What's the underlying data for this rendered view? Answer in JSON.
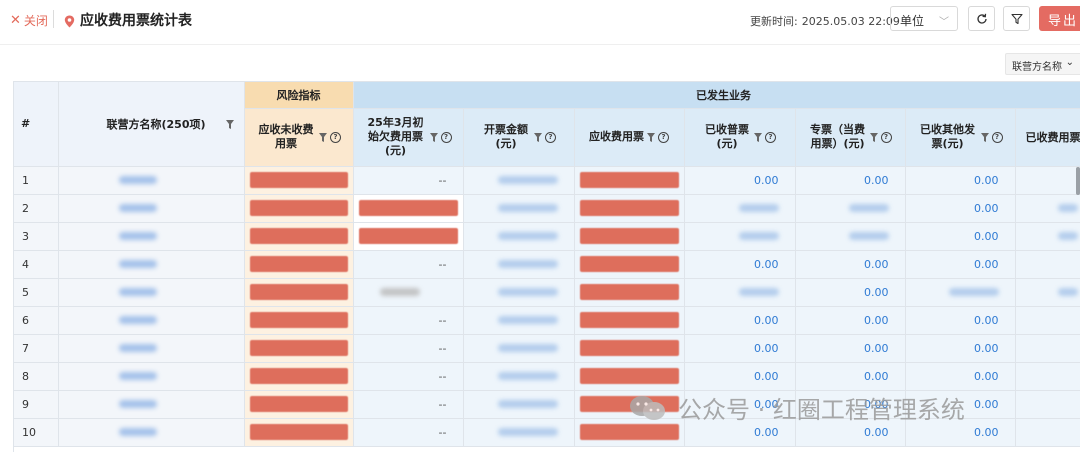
{
  "topbar": {
    "close_label": "关闭",
    "title": "应收费用票统计表",
    "update_label": "更新时间:",
    "update_time": "2025.05.03 22:09",
    "unit_label": "单位",
    "export_label": "导出"
  },
  "filter": {
    "partner_label": "联营方名称"
  },
  "table": {
    "header_idx": "#",
    "header_name": "联营方名称(250项)",
    "group_risk": "风险指标",
    "group_biz": "已发生业务",
    "col_risk": "应收未收费用票",
    "col_mar": "25年3月初始欠费用票(元)",
    "col_invoice": "开票金额(元)",
    "col_receivable": "应收费用票",
    "col_received_normal": "已收普票(元)",
    "col_special": "专票（当费用票）(元)",
    "col_other": "已收其他发票(元)",
    "col_received_fee": "已收费用票",
    "rows": [
      {
        "idx": "1",
        "mar": "--",
        "rn": "0.00",
        "sp": "0.00",
        "ot": "0.00"
      },
      {
        "idx": "2",
        "mar": "",
        "rn": "",
        "sp": "",
        "ot": "0.00"
      },
      {
        "idx": "3",
        "mar": "",
        "rn": "",
        "sp": "",
        "ot": "0.00"
      },
      {
        "idx": "4",
        "mar": "--",
        "rn": "0.00",
        "sp": "0.00",
        "ot": "0.00"
      },
      {
        "idx": "5",
        "mar": "",
        "rn": "",
        "sp": "0.00",
        "ot": ""
      },
      {
        "idx": "6",
        "mar": "--",
        "rn": "0.00",
        "sp": "0.00",
        "ot": "0.00"
      },
      {
        "idx": "7",
        "mar": "--",
        "rn": "0.00",
        "sp": "0.00",
        "ot": "0.00"
      },
      {
        "idx": "8",
        "mar": "--",
        "rn": "0.00",
        "sp": "0.00",
        "ot": "0.00"
      },
      {
        "idx": "9",
        "mar": "--",
        "rn": "0.00",
        "sp": "0.00",
        "ot": "0.00"
      },
      {
        "idx": "10",
        "mar": "--",
        "rn": "0.00",
        "sp": "0.00",
        "ot": "0.00"
      }
    ]
  },
  "watermark": {
    "text": "公众号 · 红圈工程管理系统"
  },
  "colors": {
    "accent": "#e46b62",
    "risk_bg": "#fdf1e1",
    "biz_bg": "#eef5fb",
    "link": "#2f7bd4"
  }
}
